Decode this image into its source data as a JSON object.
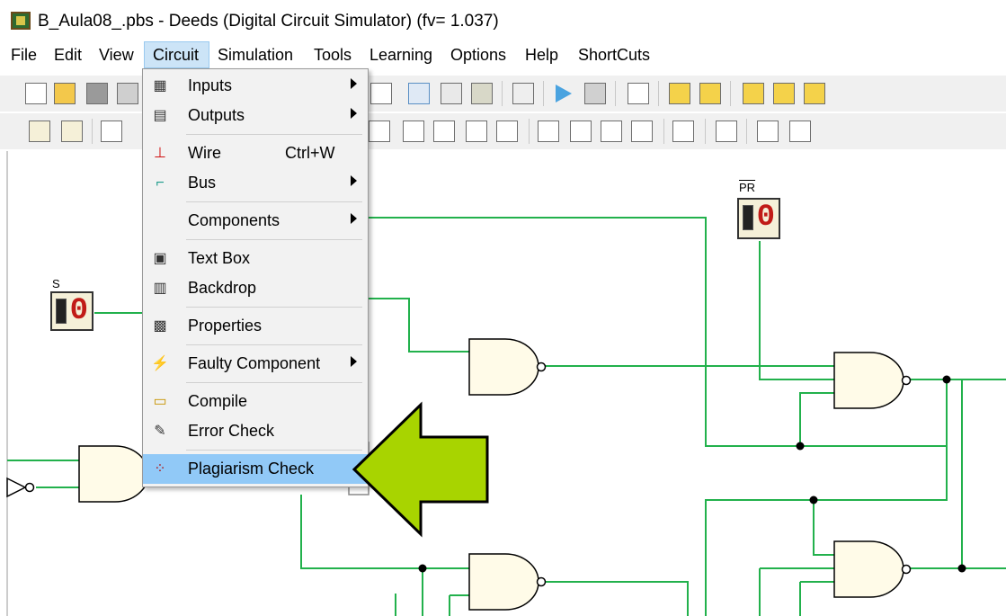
{
  "window": {
    "title": "B_Aula08_.pbs - Deeds (Digital Circuit Simulator) (fv= 1.037)"
  },
  "menubar": {
    "items": [
      {
        "label": "File"
      },
      {
        "label": "Edit"
      },
      {
        "label": "View"
      },
      {
        "label": "Circuit"
      },
      {
        "label": "Simulation"
      },
      {
        "label": "Tools"
      },
      {
        "label": "Learning"
      },
      {
        "label": "Options"
      },
      {
        "label": "Help"
      },
      {
        "label": "ShortCuts"
      }
    ],
    "active": "Circuit"
  },
  "circuit_menu": {
    "items": [
      {
        "label": "Inputs",
        "icon": "inputs-icon",
        "submenu": true
      },
      {
        "label": "Outputs",
        "icon": "outputs-icon",
        "submenu": true
      },
      {
        "label": "Wire",
        "icon": "wire-icon",
        "shortcut": "Ctrl+W"
      },
      {
        "label": "Bus",
        "icon": "bus-icon",
        "submenu": true
      },
      {
        "label": "Components",
        "icon": "",
        "submenu": true
      },
      {
        "label": "Text Box",
        "icon": "text-box-icon"
      },
      {
        "label": "Backdrop",
        "icon": "backdrop-icon"
      },
      {
        "label": "Properties",
        "icon": "properties-icon"
      },
      {
        "label": "Faulty Component",
        "icon": "lightning-icon",
        "submenu": true
      },
      {
        "label": "Compile",
        "icon": "compile-icon"
      },
      {
        "label": "Error Check",
        "icon": "error-check-icon"
      },
      {
        "label": "Plagiarism Check",
        "icon": "plagiarism-icon",
        "highlighted": true
      }
    ]
  },
  "canvas": {
    "switch_s": {
      "label": "S",
      "value": "0"
    },
    "switch_pr": {
      "label": "PR",
      "value": "0"
    }
  },
  "colors": {
    "wire": "#22b14c",
    "gate_fill": "#fffbe8",
    "arrow_fill": "#a8d400",
    "menu_highlight": "#91c9f7"
  }
}
